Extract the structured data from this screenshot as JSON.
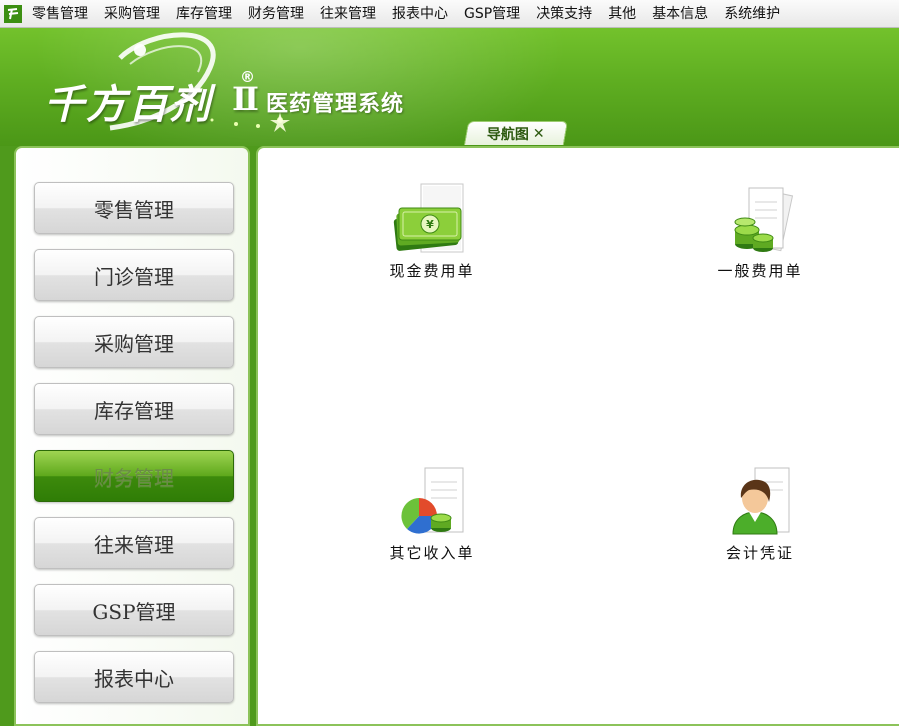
{
  "menu": [
    "零售管理",
    "采购管理",
    "库存管理",
    "财务管理",
    "往来管理",
    "报表中心",
    "GSP管理",
    "决策支持",
    "其他",
    "基本信息",
    "系统维护"
  ],
  "banner": {
    "logo": "千方百剂",
    "roman": "Ⅱ",
    "reg": "®",
    "subtitle": "医药管理系统"
  },
  "tab": {
    "label": "导航图",
    "close": "✕"
  },
  "nav": {
    "items": [
      "零售管理",
      "门诊管理",
      "采购管理",
      "库存管理",
      "财务管理",
      "往来管理",
      "GSP管理",
      "报表中心"
    ],
    "active": "财务管理"
  },
  "functions": [
    {
      "label": "现金费用单",
      "icon": "cash-document-icon"
    },
    {
      "label": "一般费用单",
      "icon": "coins-document-icon"
    },
    {
      "label": "其它收入单",
      "icon": "pie-chart-document-icon"
    },
    {
      "label": "会计凭证",
      "icon": "user-document-icon"
    }
  ],
  "colors": {
    "brand_green": "#5fae21",
    "active_button": "#3d8a0c",
    "panel_border": "#8cc35a"
  }
}
